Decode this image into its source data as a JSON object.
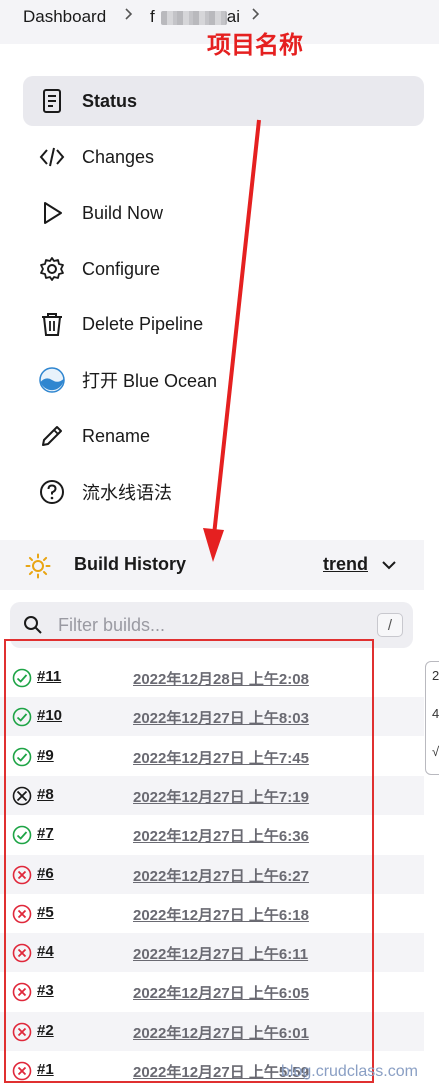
{
  "breadcrumb": {
    "items": [
      "Dashboard",
      "f",
      "ai"
    ],
    "separator": ">"
  },
  "annotation": {
    "text": "项目名称",
    "color": "#e52020"
  },
  "tasks": [
    {
      "label": "Status",
      "icon": "document-icon",
      "active": true
    },
    {
      "label": "Changes",
      "icon": "code-icon",
      "active": false
    },
    {
      "label": "Build Now",
      "icon": "play-icon",
      "active": false
    },
    {
      "label": "Configure",
      "icon": "gear-icon",
      "active": false
    },
    {
      "label": "Delete Pipeline",
      "icon": "trash-icon",
      "active": false
    },
    {
      "label": "打开 Blue Ocean",
      "icon": "blue-ocean-icon",
      "active": false
    },
    {
      "label": "Rename",
      "icon": "pencil-icon",
      "active": false
    },
    {
      "label": "流水线语法",
      "icon": "help-icon",
      "active": false
    }
  ],
  "build_history": {
    "title": "Build History",
    "trend_label": "trend",
    "filter_placeholder": "Filter builds...",
    "shortcut_key": "/",
    "builds": [
      {
        "number": "#11",
        "date": "2022年12月28日 上午2:08",
        "status": "success"
      },
      {
        "number": "#10",
        "date": "2022年12月27日 上午8:03",
        "status": "success"
      },
      {
        "number": "#9",
        "date": "2022年12月27日 上午7:45",
        "status": "success"
      },
      {
        "number": "#8",
        "date": "2022年12月27日 上午7:19",
        "status": "aborted"
      },
      {
        "number": "#7",
        "date": "2022年12月27日 上午6:36",
        "status": "success"
      },
      {
        "number": "#6",
        "date": "2022年12月27日 上午6:27",
        "status": "failed"
      },
      {
        "number": "#5",
        "date": "2022年12月27日 上午6:18",
        "status": "failed"
      },
      {
        "number": "#4",
        "date": "2022年12月27日 上午6:11",
        "status": "failed"
      },
      {
        "number": "#3",
        "date": "2022年12月27日 上午6:05",
        "status": "failed"
      },
      {
        "number": "#2",
        "date": "2022年12月27日 上午6:01",
        "status": "failed"
      },
      {
        "number": "#1",
        "date": "2022年12月27日 上午5:59",
        "status": "failed"
      }
    ]
  },
  "side_popup": {
    "glyphs": [
      "2",
      "4",
      "√"
    ]
  },
  "watermark": "blog.crudclass.com",
  "colors": {
    "success": "#1ea446",
    "failed": "#e0283b",
    "aborted": "#1a1a1a",
    "annotation": "#e52020"
  }
}
